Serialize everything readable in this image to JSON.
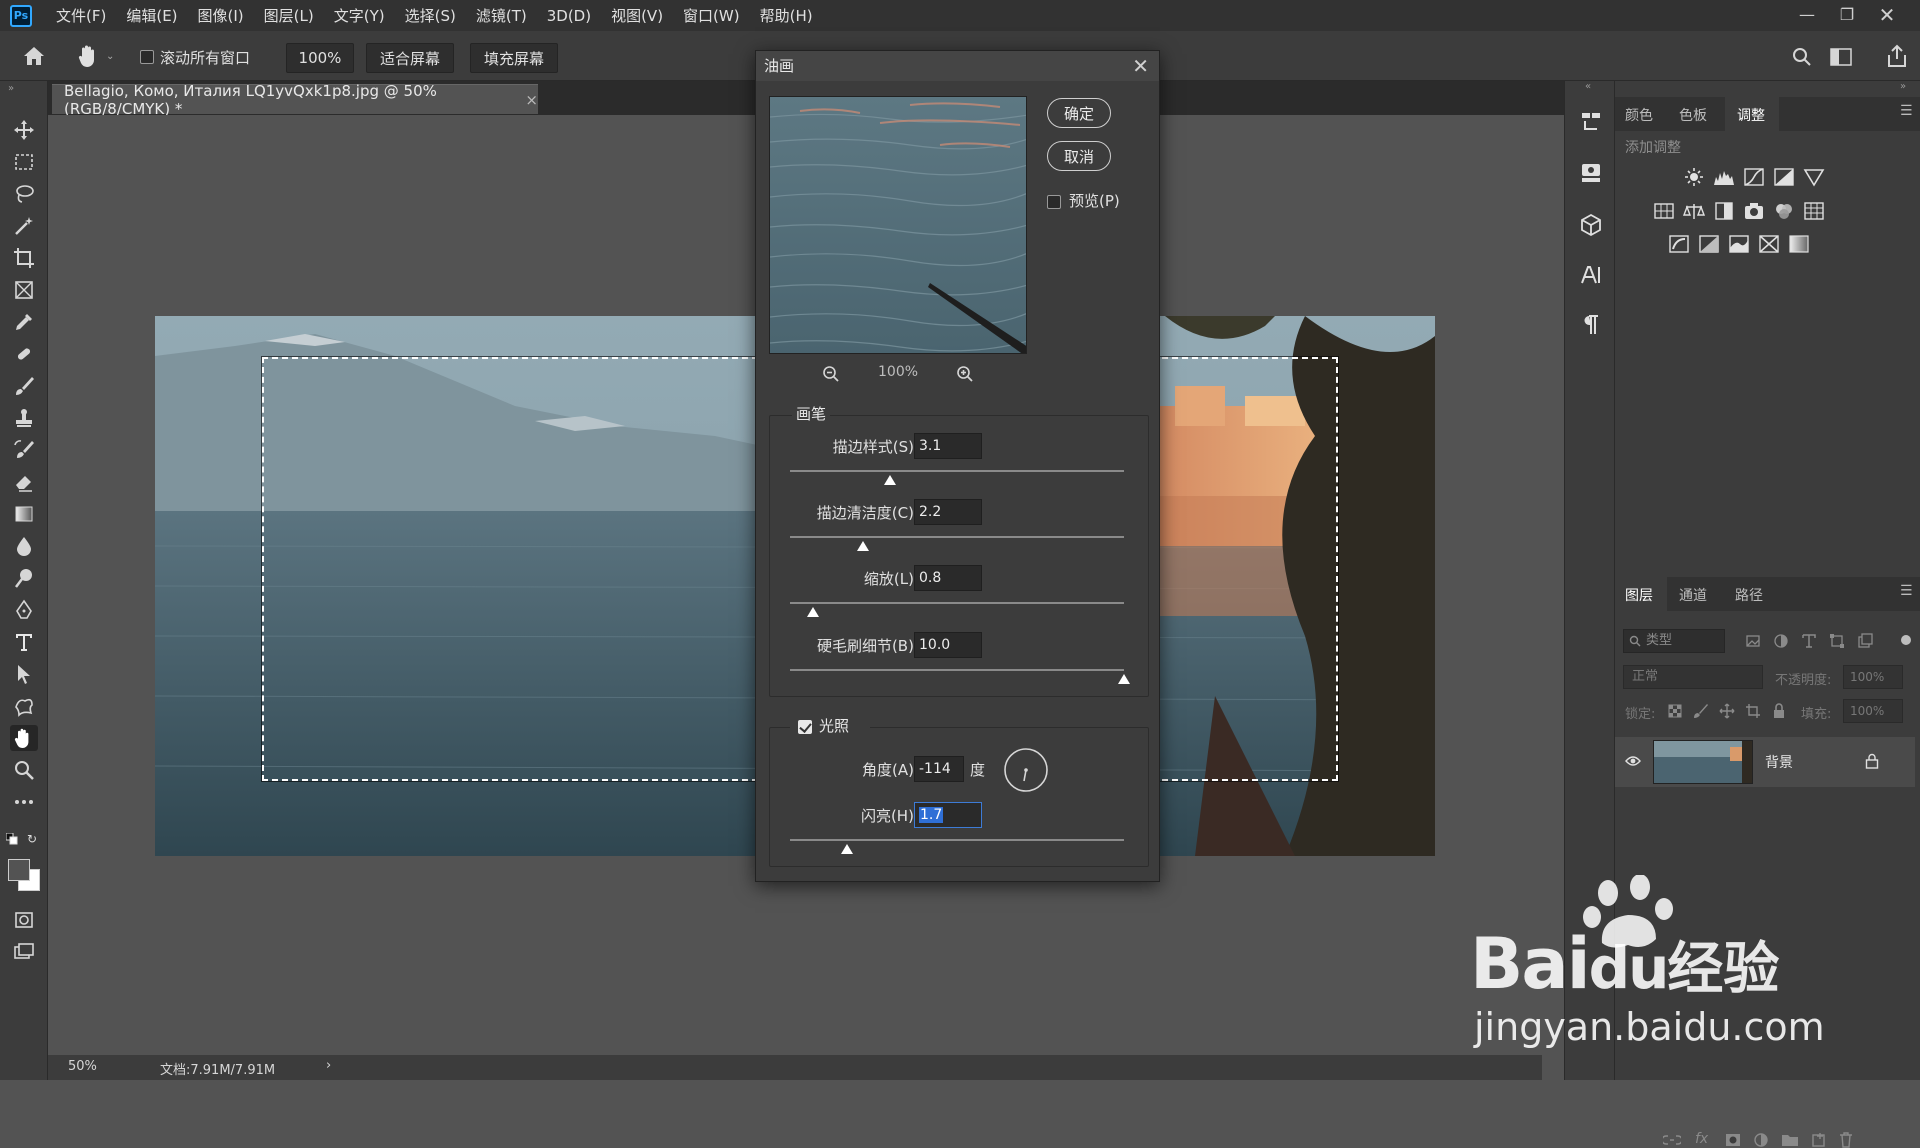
{
  "app": {
    "logo": "Ps"
  },
  "menu": [
    "文件(F)",
    "编辑(E)",
    "图像(I)",
    "图层(L)",
    "文字(Y)",
    "选择(S)",
    "滤镜(T)",
    "3D(D)",
    "视图(V)",
    "窗口(W)",
    "帮助(H)"
  ],
  "options": {
    "scroll_all_label": "滚动所有窗口",
    "zoom_value": "100%",
    "fit_screen_label": "适合屏幕",
    "fill_screen_label": "填充屏幕"
  },
  "document": {
    "tab_title": "Bellagio, Комо, Италия LQ1yvQxk1p8.jpg @ 50%(RGB/8/CMYK) *",
    "close_glyph": "×"
  },
  "status": {
    "zoom": "50%",
    "doc_info": "文档:7.91M/7.91M",
    "arrow": "›"
  },
  "dialog": {
    "title": "油画",
    "ok_label": "确定",
    "cancel_label": "取消",
    "preview_label": "预览(P)",
    "preview_checked": false,
    "preview_zoom": "100%",
    "brush": {
      "group_label": "画笔",
      "stylization": {
        "label": "描边样式(S):",
        "value": "3.1",
        "fraction": 0.3
      },
      "cleanliness": {
        "label": "描边清洁度(C):",
        "value": "2.2",
        "fraction": 0.22
      },
      "scale": {
        "label": "缩放(L):",
        "value": "0.8",
        "fraction": 0.07
      },
      "bristle": {
        "label": "硬毛刷细节(B):",
        "value": "10.0",
        "fraction": 1.0
      }
    },
    "lighting": {
      "group_label": "光照",
      "checked": true,
      "angle": {
        "label": "角度(A):",
        "value": "-114",
        "unit": "度"
      },
      "shine": {
        "label": "闪亮(H):",
        "value": "1.7",
        "fraction": 0.17
      }
    }
  },
  "adjust_panel": {
    "tabs": [
      "颜色",
      "色板",
      "调整"
    ],
    "active_tab": "调整",
    "add_adjustment_label": "添加调整"
  },
  "layers_panel": {
    "tabs": [
      "图层",
      "通道",
      "路径"
    ],
    "active_tab": "图层",
    "filter_kind": "类型",
    "blend_mode": "正常",
    "opacity_label": "不透明度:",
    "opacity_value": "100%",
    "lock_label": "锁定:",
    "fill_label": "填充:",
    "fill_value": "100%",
    "layers": [
      {
        "name": "背景",
        "visible": true,
        "locked": true
      }
    ]
  },
  "watermark": {
    "brand": "Bai",
    "brand2": "du",
    "suffix": "经验",
    "url": "jingyan.baidu.com"
  },
  "colors": {
    "accent": "#31a8ff",
    "menubar": "#323232",
    "panel": "#3c3c3c",
    "canvas": "#535353"
  }
}
